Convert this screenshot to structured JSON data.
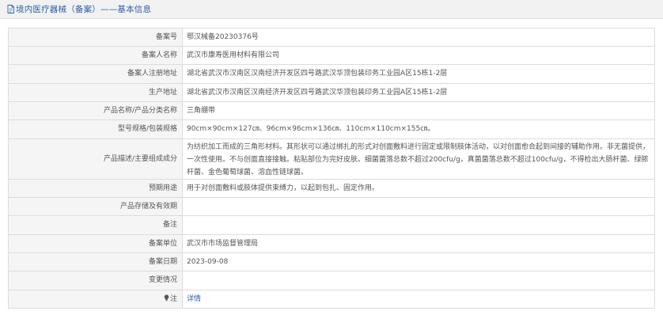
{
  "header": {
    "title": "境内医疗器械（备案）——基本信息",
    "icon": "document-icon"
  },
  "rows": [
    {
      "label": "备案号",
      "value": "鄂汉械备20230376号"
    },
    {
      "label": "备案人名称",
      "value": "武汉市康寿医用材料有限公司"
    },
    {
      "label": "备案人注册地址",
      "value": "湖北省武汉市汉南区汉南经济开发区四号路武汉华顶包装印务工业园A区15栋1-2层"
    },
    {
      "label": "生产地址",
      "value": "湖北省武汉市汉南区汉南经济开发区四号路武汉华顶包装印务工业园A区15栋1-2层"
    },
    {
      "label": "产品名称/产品分类名称",
      "value": "三角绷带"
    },
    {
      "label": "型号规格/包装规格",
      "value": "90cm×90cm×127㎝、96cm×96cm×136㎝、110cm×110cm×155㎝。"
    },
    {
      "label": "产品描述/主要组成成分",
      "value": "为纺织加工而成的三角形材料。其形状可以通过绑扎的形式对创面敷料进行固定或限制肢体活动，以对创面愈合起到间接的辅助作用。非无菌提供，一次性使用。不与创面直接接触。粘贴部位为完好皮肤。细菌菌落总数不超过200cfu/g，真菌菌落总数不超过100cfu/g，不得检出大肠杆菌、绿脓杆菌、金色葡萄球菌、溶血性链球菌。"
    },
    {
      "label": "预期用途",
      "value": "用于对创面敷料或肢体提供束缚力，以起到包扎、固定作用。"
    },
    {
      "label": "产品存储及有效期",
      "value": ""
    },
    {
      "label": "备注",
      "value": ""
    },
    {
      "label": "备案单位",
      "value": "武汉市市场监督管理局"
    },
    {
      "label": "备案日期",
      "value": "2023-09-08"
    },
    {
      "label": "变更情况",
      "value": ""
    }
  ],
  "note": {
    "label": "注",
    "icon": "lightbulb-icon",
    "link_text": "详情"
  },
  "colors": {
    "accent": "#2d5fa6",
    "label_bg": "#f5f5f5",
    "border": "#dcdcdc",
    "header_bg": "#f2f2f2"
  }
}
